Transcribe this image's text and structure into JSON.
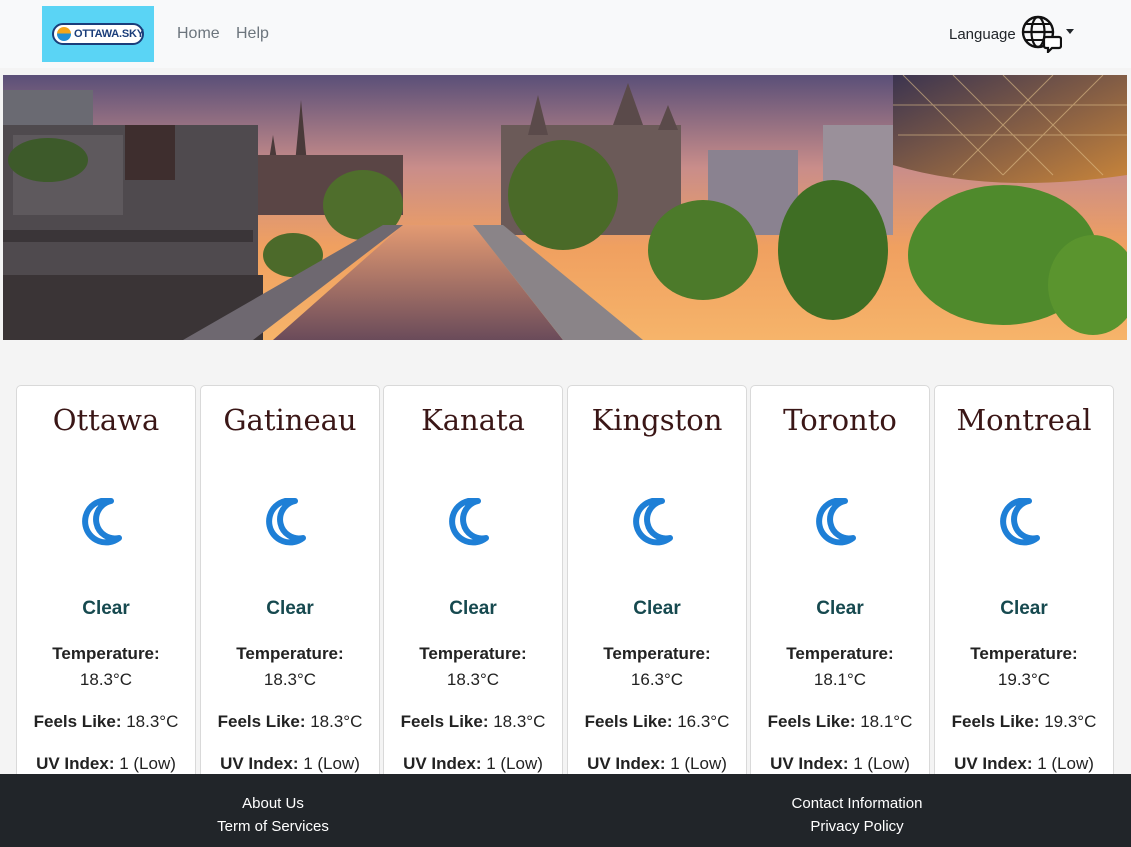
{
  "navbar": {
    "logo_text": "OTTAWA.SKY",
    "links": [
      "Home",
      "Help"
    ],
    "language_label": "Language"
  },
  "hero": {
    "image": "ottawa-canal-sunset-skyline"
  },
  "cities": [
    {
      "name": "Ottawa",
      "condition": "Clear",
      "icon": "moon-icon",
      "temperature_label": "Temperature:",
      "temperature": "18.3°C",
      "feels_label": "Feels Like:",
      "feels_like": "18.3°C",
      "uv_label": "UV Index:",
      "uv_index": "1 (Low)"
    },
    {
      "name": "Gatineau",
      "condition": "Clear",
      "icon": "moon-icon",
      "temperature_label": "Temperature:",
      "temperature": "18.3°C",
      "feels_label": "Feels Like:",
      "feels_like": "18.3°C",
      "uv_label": "UV Index:",
      "uv_index": "1 (Low)"
    },
    {
      "name": "Kanata",
      "condition": "Clear",
      "icon": "moon-icon",
      "temperature_label": "Temperature:",
      "temperature": "18.3°C",
      "feels_label": "Feels Like:",
      "feels_like": "18.3°C",
      "uv_label": "UV Index:",
      "uv_index": "1 (Low)"
    },
    {
      "name": "Kingston",
      "condition": "Clear",
      "icon": "moon-icon",
      "temperature_label": "Temperature:",
      "temperature": "16.3°C",
      "feels_label": "Feels Like:",
      "feels_like": "16.3°C",
      "uv_label": "UV Index:",
      "uv_index": "1 (Low)"
    },
    {
      "name": "Toronto",
      "condition": "Clear",
      "icon": "moon-icon",
      "temperature_label": "Temperature:",
      "temperature": "18.1°C",
      "feels_label": "Feels Like:",
      "feels_like": "18.1°C",
      "uv_label": "UV Index:",
      "uv_index": "1 (Low)"
    },
    {
      "name": "Montreal",
      "condition": "Clear",
      "icon": "moon-icon",
      "temperature_label": "Temperature:",
      "temperature": "19.3°C",
      "feels_label": "Feels Like:",
      "feels_like": "19.3°C",
      "uv_label": "UV Index:",
      "uv_index": "1 (Low)"
    }
  ],
  "footer": {
    "about": "About Us",
    "terms": "Term of Services",
    "contact": "Contact Information",
    "privacy": "Privacy Policy"
  },
  "colors": {
    "navbar_bg": "#f8f9fa",
    "logo_bg": "#5ad4f5",
    "footer_bg": "#212529",
    "condition_text": "#16494f",
    "city_title": "#3a1616",
    "moon_icon": "#1e7fd6"
  }
}
